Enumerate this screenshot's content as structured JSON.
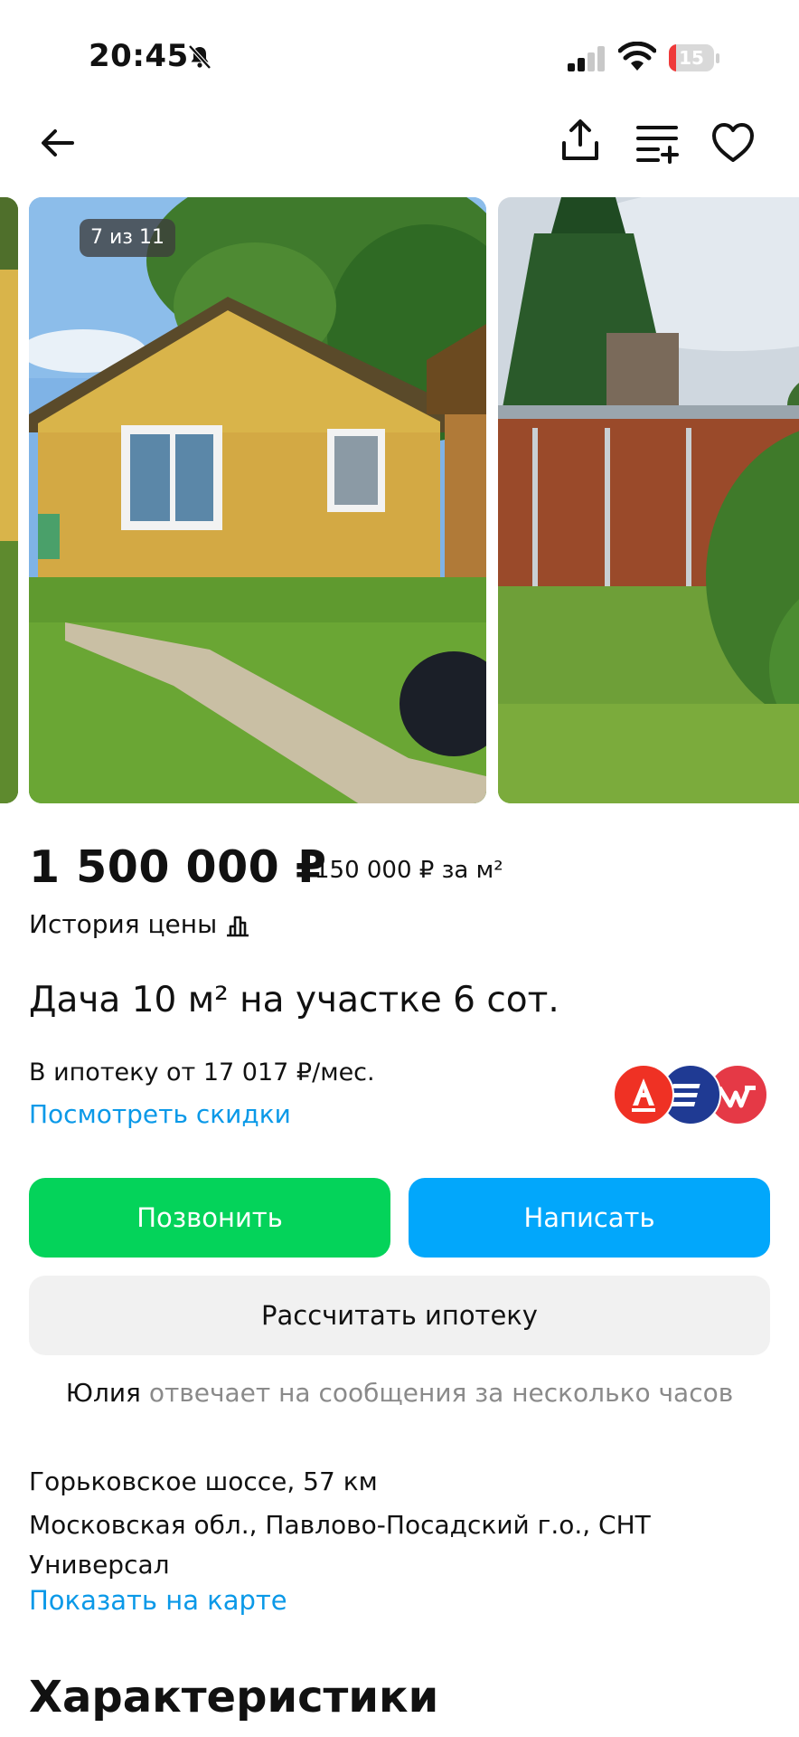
{
  "status_bar": {
    "time": "20:45",
    "battery_level": 15,
    "battery_label": "15",
    "icons": [
      "bell-slash-icon",
      "signal-icon",
      "wifi-icon",
      "battery-icon"
    ]
  },
  "nav": {
    "icons": [
      "arrow-left-icon",
      "share-icon",
      "compare-icon",
      "heart-icon"
    ]
  },
  "gallery": {
    "counter": "7 из 11",
    "current": 7,
    "total": 11
  },
  "listing": {
    "price": "1 500 000 ₽",
    "price_per_m2": "150 000 ₽ за м²",
    "price_history_label": "История цены",
    "title": "Дача 10 м² на участке 6 сот.",
    "mortgage_text": "В ипотеку от 17 017 ₽/мес.",
    "discounts_link": "Посмотреть скидки"
  },
  "banks": {
    "colors": [
      "#ef3124",
      "#1f3a93",
      "#e53946"
    ]
  },
  "actions": {
    "call_label": "Позвонить",
    "write_label": "Написать",
    "mortgage_calc_label": "Рассчитать ипотеку",
    "call_color": "#04d35a",
    "write_color": "#02a7fb"
  },
  "seller": {
    "name": "Юлия",
    "response_text": "отвечает на сообщения за несколько часов"
  },
  "address": {
    "highway": "Горьковское шоссе, 57 км",
    "region": "Московская обл., Павлово-Посадский г.о., СНТ Универсал",
    "map_link": "Показать на карте"
  },
  "sections": {
    "characteristics_heading": "Характеристики"
  },
  "colors": {
    "link": "#0a99e8",
    "muted_text": "#8a8a8a"
  }
}
